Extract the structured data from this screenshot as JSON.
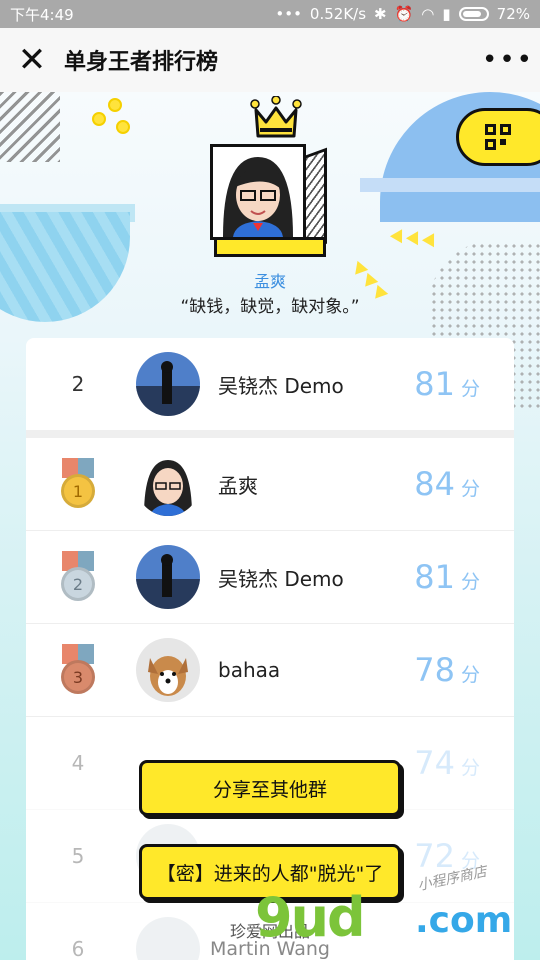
{
  "status": {
    "time": "下午4:49",
    "speed": "0.52K/s",
    "battery": "72%"
  },
  "nav": {
    "title": "单身王者排行榜",
    "close_glyph": "✕",
    "more_glyph": "•••"
  },
  "champion": {
    "name": "孟爽",
    "quote": "“缺钱，缺觉，缺对象。”"
  },
  "self_row": {
    "rank": "2",
    "name": "吴铙杰 Demo",
    "score": "81",
    "unit": "分"
  },
  "rows": [
    {
      "rank": "1",
      "medal": "gold-medal-icon",
      "name": "孟爽",
      "score": "84",
      "unit": "分"
    },
    {
      "rank": "2",
      "medal": "silver-medal-icon",
      "name": "吴铙杰 Demo",
      "score": "81",
      "unit": "分"
    },
    {
      "rank": "3",
      "medal": "bronze-medal-icon",
      "name": "bahaa",
      "score": "78",
      "unit": "分"
    },
    {
      "rank": "4",
      "name": "",
      "score": "74",
      "unit": "分"
    },
    {
      "rank": "5",
      "name": "",
      "score": "72",
      "unit": "分"
    },
    {
      "rank": "6",
      "name": "",
      "score": "",
      "unit": ""
    }
  ],
  "actions": {
    "share": "分享至其他群",
    "secret": "【密】进来的人都\"脱光\"了"
  },
  "footer": {
    "credit": "珍爱网出品",
    "author": "Martin Wang"
  },
  "watermark": {
    "logo": "9ud",
    "domain": ".com",
    "tag": "小程序商店"
  },
  "colors": {
    "accent_yellow": "#ffe82a",
    "score_blue": "#8ec4f4",
    "name_blue": "#3c8fe0"
  }
}
